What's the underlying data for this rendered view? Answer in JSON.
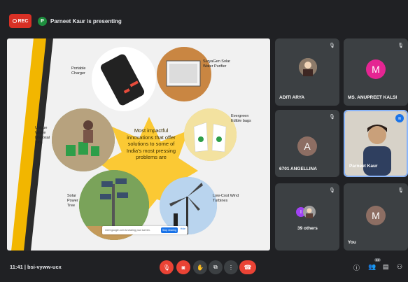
{
  "header": {
    "rec_label": "REC",
    "presenter_initial": "P",
    "presenter_text": "Parneet Kaur is presenting"
  },
  "slide": {
    "center_text": "Most impactful innovations that offer solutions to some of India's most pressing problems are",
    "labels": {
      "charger": "Portable Charger",
      "purifier": "SuryaGen Solar Water Purifier",
      "bins": "Unique Waste Disposal Bins",
      "bags": "Evergreen Edible bags",
      "tree": "Solar Power Tree",
      "wind": "Low-Cost Wind Turbines"
    },
    "share_bar": {
      "text": "meet.google.com is sharing your screen.",
      "stop_label": "Stop sharing",
      "hide_label": "Hide"
    }
  },
  "participants": [
    {
      "name": "ADITI ARYA",
      "initial": ""
    },
    {
      "name": "MS. ANUPREET KALSI",
      "initial": "M",
      "color": "#e52592"
    },
    {
      "name": "6701 ANGELLINA",
      "initial": "A",
      "color": "#8d6e63"
    },
    {
      "name": "Parneet Kaur",
      "initial": ""
    },
    {
      "name": "39 others",
      "initial": "I",
      "color": "#a142f4"
    },
    {
      "name": "You",
      "initial": "M",
      "color": "#8d6e63"
    }
  ],
  "footer": {
    "meeting_info": "11:41 | bsi-vyww-ucx",
    "people_count": "42"
  },
  "colors": {
    "rec": "#d93025",
    "accent": "#1a73e8",
    "danger": "#ea4335",
    "bg": "#202124"
  }
}
